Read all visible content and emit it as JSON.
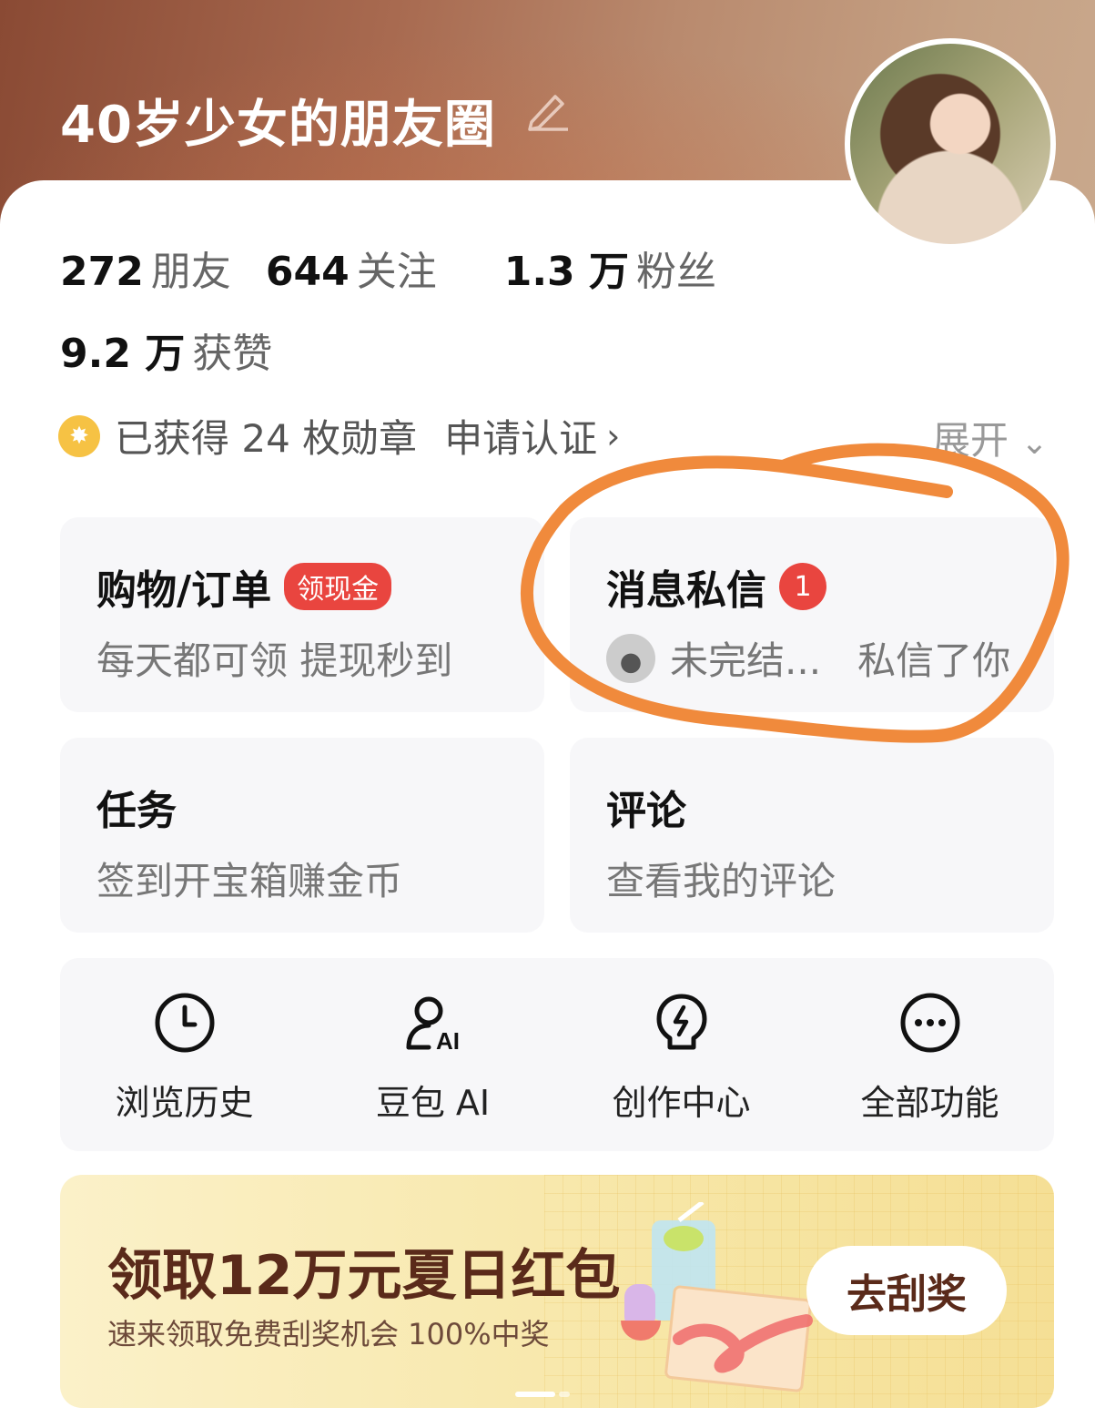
{
  "profile": {
    "title": "40岁少女的朋友圈"
  },
  "stats": [
    {
      "num": "272",
      "label": "朋友"
    },
    {
      "num": "644",
      "label": "关注"
    },
    {
      "num": "1.3 万",
      "label": "粉丝"
    },
    {
      "num": "9.2 万",
      "label": "获赞"
    }
  ],
  "badges": {
    "text": "已获得 24 枚勋章",
    "apply": "申请认证",
    "apply_chevron": "›",
    "expand": "展开",
    "expand_chevron": "⌄"
  },
  "tiles": {
    "shopping": {
      "title": "购物/订单",
      "badge": "领现金",
      "sub": "每天都可领 提现秒到"
    },
    "messages": {
      "title": "消息私信",
      "count": "1",
      "sender": "未完结...",
      "action": "私信了你"
    },
    "tasks": {
      "title": "任务",
      "sub": "签到开宝箱赚金币"
    },
    "comments": {
      "title": "评论",
      "sub": "查看我的评论"
    }
  },
  "quick": [
    {
      "label": "浏览历史",
      "icon": "clock-icon"
    },
    {
      "label": "豆包 AI",
      "icon": "ai-person-icon"
    },
    {
      "label": "创作中心",
      "icon": "bulb-icon"
    },
    {
      "label": "全部功能",
      "icon": "more-icon"
    }
  ],
  "promo": {
    "title": "领取12万元夏日红包",
    "sub": "速来领取免费刮奖机会 100%中奖",
    "button": "去刮奖"
  },
  "colors": {
    "accent_red": "#e9453f",
    "annotation_orange": "#f08a3c",
    "medal_gold": "#f6c244"
  }
}
